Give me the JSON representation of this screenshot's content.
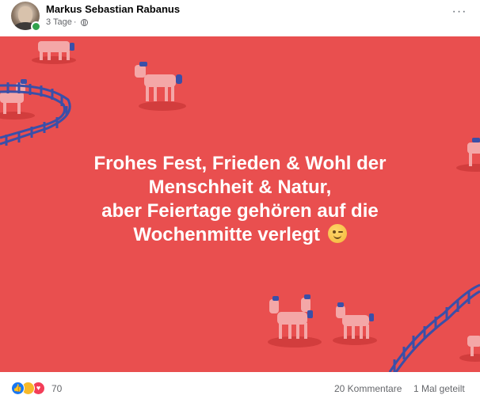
{
  "post": {
    "author": "Markus Sebastian Rabanus",
    "time": "3 Tage",
    "separator": "·",
    "more_label": "···",
    "image_text": {
      "line1": "Frohes Fest, Frieden & Wohl der",
      "line2": "Menschheit & Natur,",
      "line3": "aber Feiertage gehören auf die",
      "line4": "Wochenmitte verlegt"
    },
    "background_color": "#e94f4f",
    "fence_color": "#3a4fa8",
    "unicorn_color": "#f4a7a7"
  },
  "footer": {
    "reaction_icons": [
      "like-icon",
      "haha-icon",
      "love-icon"
    ],
    "reaction_count": "70",
    "comments": "20 Kommentare",
    "shares": "1 Mal geteilt"
  }
}
